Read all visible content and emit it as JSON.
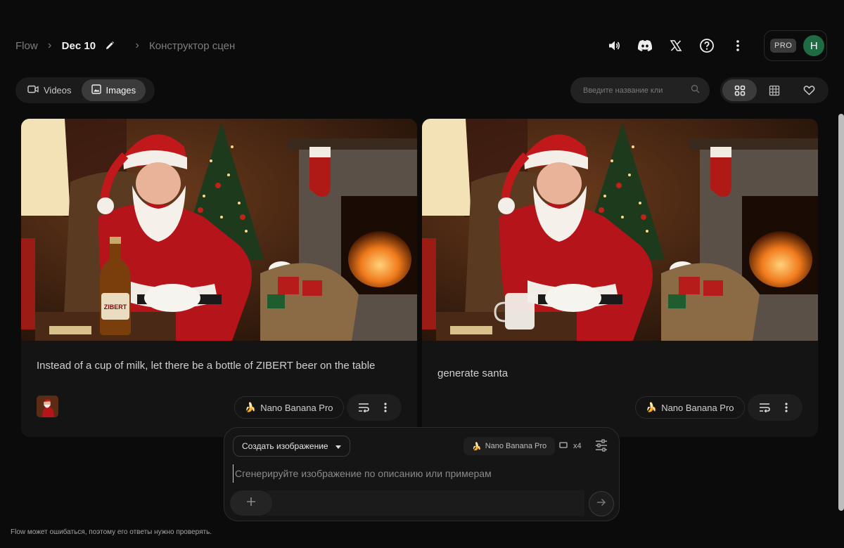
{
  "header": {
    "breadcrumb": {
      "root": "Flow",
      "current": "Dec 10",
      "section": "Конструктор сцен"
    },
    "icons": [
      "volume-icon",
      "discord-icon",
      "x-logo-icon",
      "help-icon",
      "more-vertical-icon"
    ],
    "account": {
      "plan": "PRO",
      "avatar_initial": "H"
    }
  },
  "toolbar": {
    "tabs": [
      {
        "label": "Videos",
        "icon": "video-icon",
        "active": false
      },
      {
        "label": "Images",
        "icon": "image-icon",
        "active": true
      }
    ],
    "search": {
      "placeholder": "Введите название кли"
    },
    "views": [
      "grid-large-icon",
      "grid-small-icon",
      "heart-icon"
    ]
  },
  "cards": [
    {
      "prompt": "Instead of a cup of milk, let there be a bottle of ZIBERT beer on the table",
      "model": "Nano Banana Pro",
      "bottle_label": "ZIBERT",
      "has_reference_thumb": true
    },
    {
      "prompt": "generate santa",
      "model": "Nano Banana Pro",
      "has_reference_thumb": false
    }
  ],
  "composer": {
    "mode": "Создать изображение",
    "model": "Nano Banana Pro",
    "count": "x4",
    "placeholder": "Сгенерируйте изображение по описанию или примерам"
  },
  "footer": {
    "disclaimer": "Flow может ошибаться, поэтому его ответы нужно проверять."
  },
  "colors": {
    "background": "#0b0b0b",
    "card": "#141414",
    "avatar": "#1f6b43"
  }
}
